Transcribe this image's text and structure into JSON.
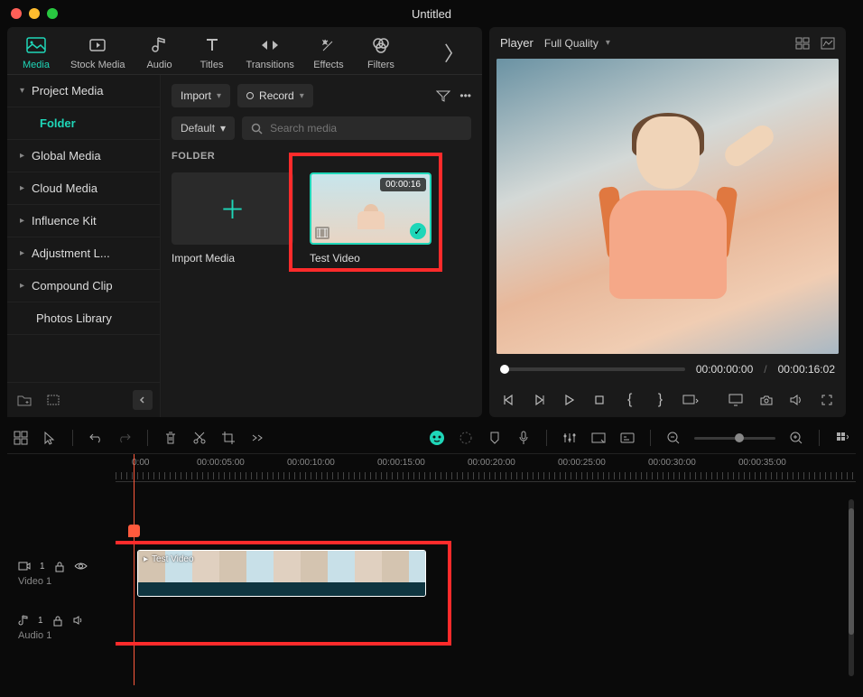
{
  "title": "Untitled",
  "top_tabs": {
    "media": "Media",
    "stock_media": "Stock Media",
    "audio": "Audio",
    "titles": "Titles",
    "transitions": "Transitions",
    "effects": "Effects",
    "filters": "Filters"
  },
  "sidebar": {
    "project_media": "Project Media",
    "folder": "Folder",
    "global_media": "Global Media",
    "cloud_media": "Cloud Media",
    "influence_kit": "Influence Kit",
    "adjustment": "Adjustment L...",
    "compound_clip": "Compound Clip",
    "photos_library": "Photos Library"
  },
  "media_toolbar": {
    "import": "Import",
    "record": "Record",
    "default": "Default",
    "search_placeholder": "Search media",
    "folder_label": "FOLDER"
  },
  "media_items": {
    "import_media": "Import Media",
    "test_video": "Test Video",
    "test_video_duration": "00:00:16"
  },
  "player": {
    "label": "Player",
    "quality": "Full Quality",
    "current_time": "00:00:00:00",
    "total_time": "00:00:16:02"
  },
  "timeline": {
    "ruler": [
      "0:00",
      "00:00:05:00",
      "00:00:10:00",
      "00:00:15:00",
      "00:00:20:00",
      "00:00:25:00",
      "00:00:30:00",
      "00:00:35:00"
    ],
    "video_track_num": "1",
    "video_track": "Video 1",
    "audio_track_num": "1",
    "audio_track": "Audio 1",
    "clip_label": "Test Video"
  }
}
